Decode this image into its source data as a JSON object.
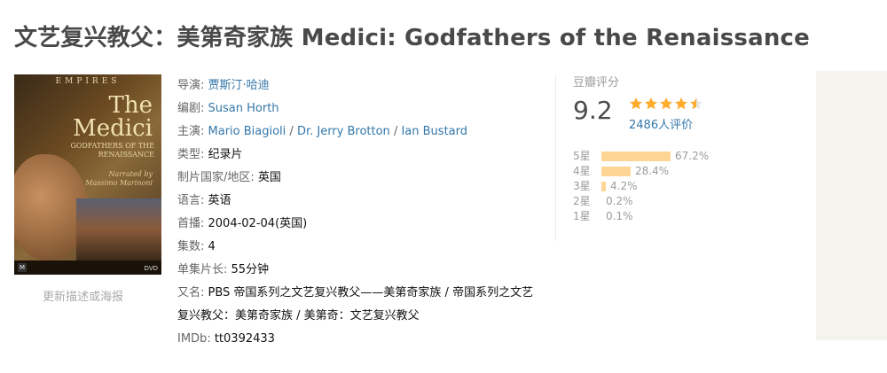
{
  "title": "文艺复兴教父：美第奇家族 Medici: Godfathers of the Renaissance",
  "poster": {
    "empires": "EMPIRES",
    "title_line1": "The",
    "title_line2": "Medici",
    "subtitle_line1": "GODFATHERS OF THE",
    "subtitle_line2": "RENAISSANCE",
    "narrated_line1": "Narrated by",
    "narrated_line2": "Massimo Marinoni",
    "rating_mark": "M",
    "dvd_mark": "DVD"
  },
  "update_link": "更新描述或海报",
  "info": {
    "director_label": "导演: ",
    "director": "贾斯汀·哈迪",
    "writer_label": "编剧: ",
    "writer": "Susan Horth",
    "cast_label": "主演: ",
    "cast": [
      "Mario Biagioli",
      "Dr. Jerry Brotton",
      "Ian Bustard"
    ],
    "cast_sep": " / ",
    "genre_label": "类型: ",
    "genre": "纪录片",
    "country_label": "制片国家/地区: ",
    "country": "英国",
    "language_label": "语言: ",
    "language": "英语",
    "premiere_label": "首播: ",
    "premiere": "2004-02-04(英国)",
    "episodes_label": "集数: ",
    "episodes": "4",
    "runtime_label": "单集片长: ",
    "runtime": "55分钟",
    "aka_label": "又名: ",
    "aka": "PBS 帝国系列之文艺复兴教父——美第奇家族 / 帝国系列之文艺复兴教父：美第奇家族 / 美第奇：文艺复兴教父",
    "imdb_label": "IMDb: ",
    "imdb": "tt0392433"
  },
  "rating": {
    "label": "豆瓣评分",
    "score": "9.2",
    "stars": 4.5,
    "votes": "2486人评价",
    "distribution": [
      {
        "label": "5星",
        "pct": "67.2%",
        "value": 67.2
      },
      {
        "label": "4星",
        "pct": "28.4%",
        "value": 28.4
      },
      {
        "label": "3星",
        "pct": "4.2%",
        "value": 4.2
      },
      {
        "label": "2星",
        "pct": "0.2%",
        "value": 0.2
      },
      {
        "label": "1星",
        "pct": "0.1%",
        "value": 0.1
      }
    ]
  },
  "colors": {
    "link": "#3377aa",
    "star": "#ffac2d",
    "bar": "#ffd596",
    "label": "#666666"
  }
}
